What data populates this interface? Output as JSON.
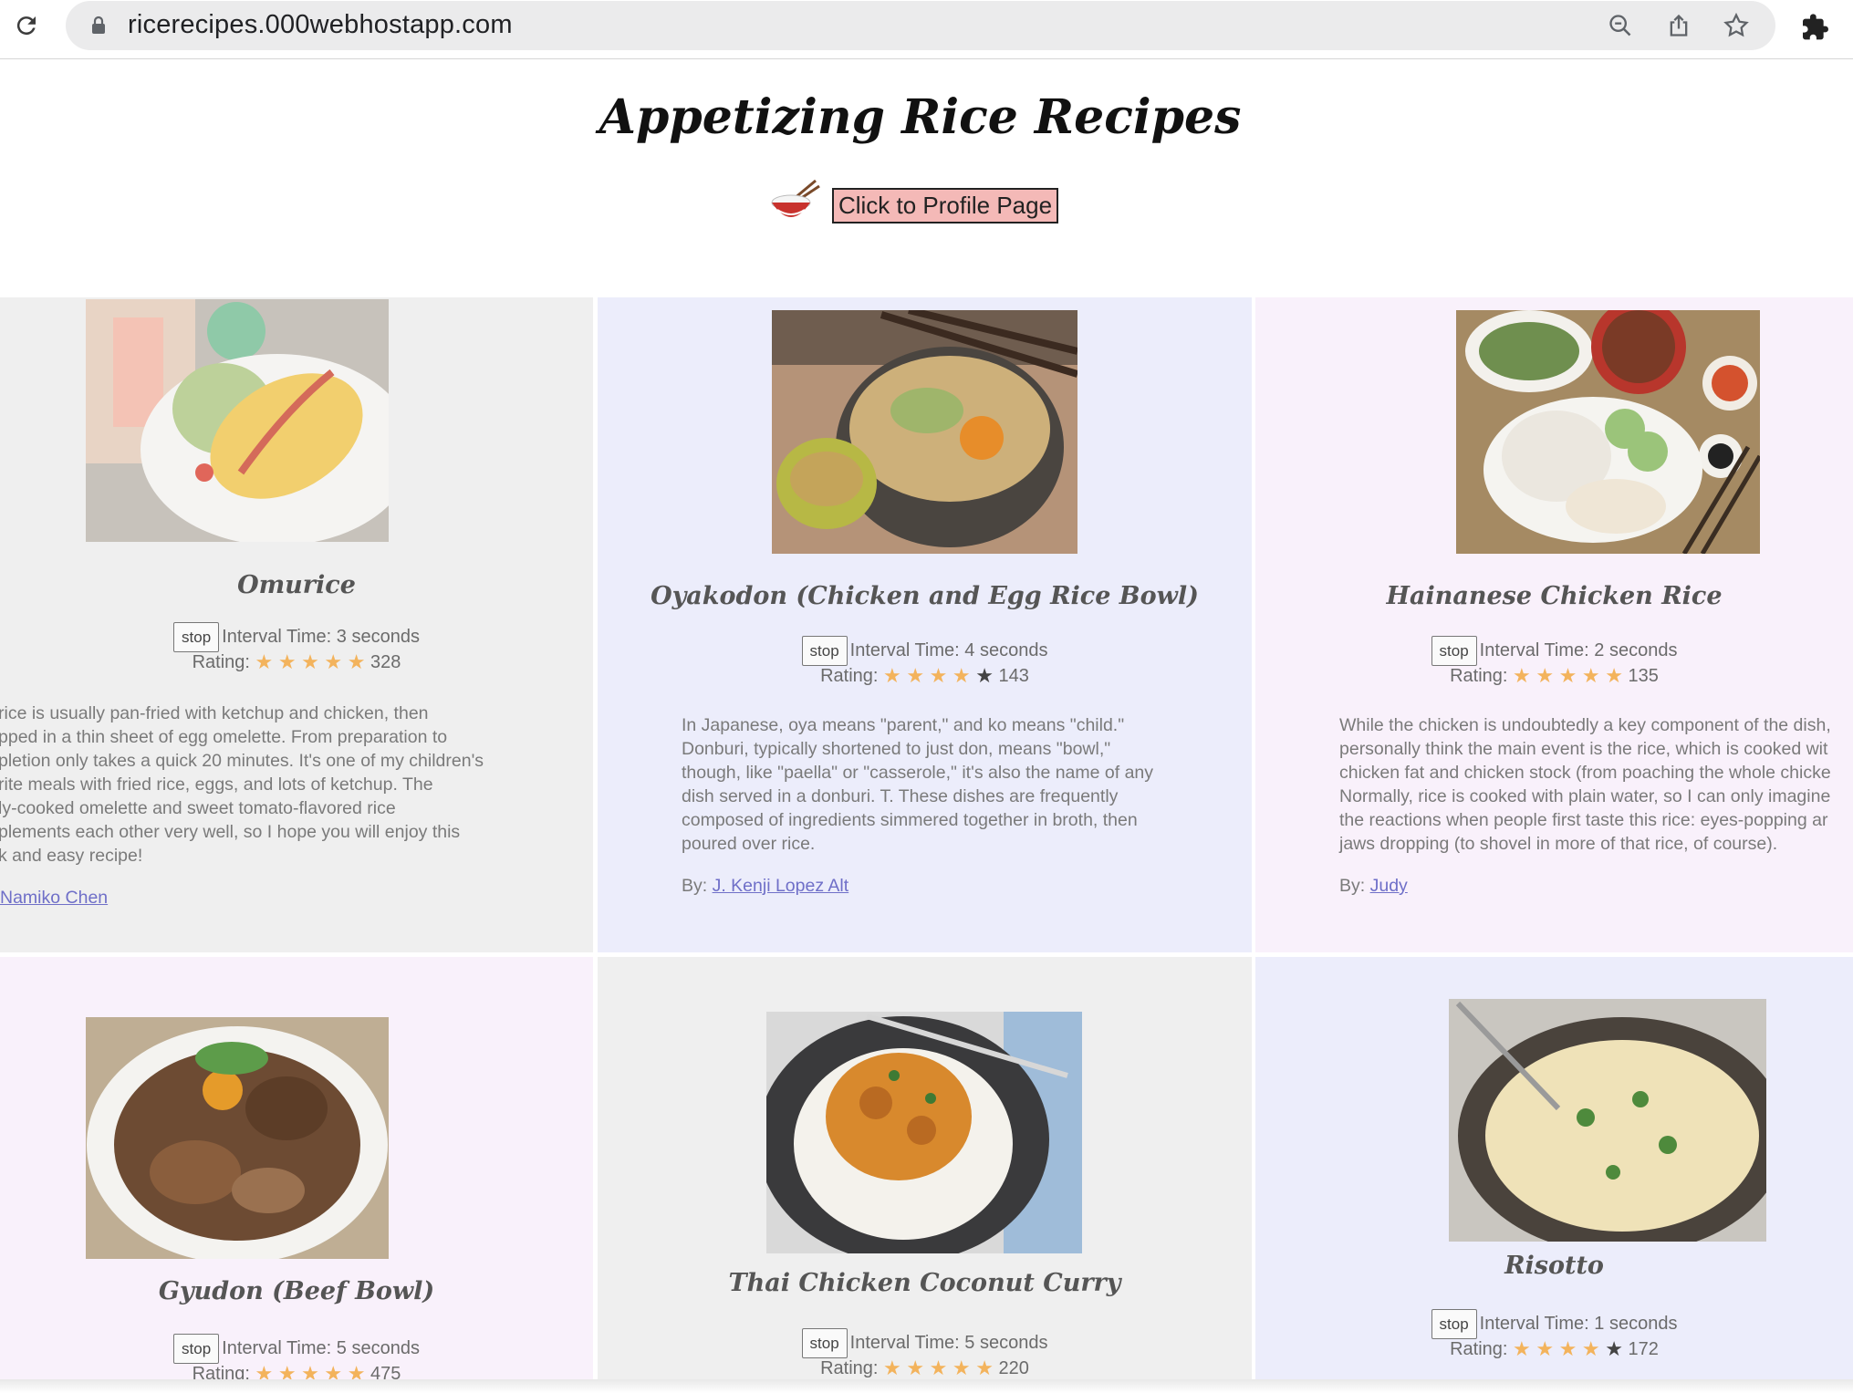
{
  "browser": {
    "url": "ricerecipes.000webhostapp.com"
  },
  "page": {
    "title": "Appetizing Rice Recipes",
    "profile_button": "Click to Profile Page"
  },
  "labels": {
    "stop": "stop",
    "interval_prefix": "Interval Time: ",
    "interval_suffix": " seconds",
    "rating_prefix": "Rating: ",
    "by_prefix": "By: "
  },
  "recipes": [
    {
      "name": "Omurice",
      "interval": "3",
      "stars": 5,
      "rating_count": "328",
      "description": [
        "rice is usually pan-fried with ketchup and chicken, then",
        "pped in a thin sheet of egg omelette. From preparation to",
        "pletion only takes a quick 20 minutes. It's one of my children's",
        "rite meals with fried rice, eggs, and lots of ketchup. The",
        "ly-cooked omelette and sweet tomato-flavored rice",
        "plements each other very well, so I hope you will enjoy this",
        "k and easy recipe!"
      ],
      "author": "Namiko Chen",
      "image": "omurice-photo"
    },
    {
      "name": "Oyakodon (Chicken and Egg Rice Bowl)",
      "interval": "4",
      "stars": 4,
      "rating_count": "143",
      "description": [
        "In Japanese, oya means \"parent,\" and ko means \"child.\"",
        "Donburi, typically shortened to just don, means \"bowl,\"",
        "though, like \"paella\" or \"casserole,\" it's also the name of any",
        "dish served in a donburi. T. These dishes are frequently",
        "composed of ingredients simmered together in broth, then",
        "poured over rice."
      ],
      "author": "J. Kenji Lopez Alt",
      "image": "oyakodon-photo"
    },
    {
      "name": "Hainanese Chicken Rice",
      "interval": "2",
      "stars": 5,
      "rating_count": "135",
      "description": [
        "While the chicken is undoubtedly a key component of the dish,",
        "personally think the main event is the rice, which is cooked wit",
        "chicken fat and chicken stock (from poaching the whole chicke",
        "Normally, rice is cooked with plain water, so I can only imagine",
        "the reactions when people first taste this rice: eyes-popping ar",
        "jaws dropping (to shovel in more of that rice, of course)."
      ],
      "author": "Judy",
      "image": "hainanese-chicken-rice-photo"
    },
    {
      "name": "Gyudon (Beef Bowl)",
      "interval": "5",
      "stars": 5,
      "rating_count": "475",
      "image": "gyudon-photo"
    },
    {
      "name": "Thai Chicken Coconut Curry",
      "interval": "5",
      "stars": 5,
      "rating_count": "220",
      "image": "thai-curry-photo"
    },
    {
      "name": "Risotto",
      "interval": "1",
      "stars": 4,
      "rating_count": "172",
      "image": "risotto-photo"
    }
  ],
  "colors": {
    "card_gray": "#efefef",
    "card_blue": "#ecedfb",
    "card_pink": "#f9f1fb",
    "star_on": "#f3b35c",
    "star_off": "#444444",
    "button_pink": "#f4b9b7",
    "link": "#6f6fc8"
  }
}
